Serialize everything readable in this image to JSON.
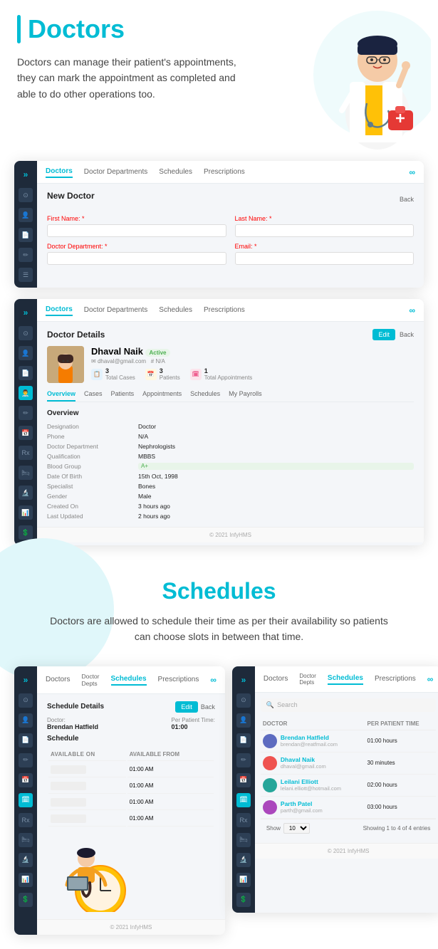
{
  "doctors_section": {
    "title": "Doctors",
    "description": "Doctors can manage their patient's appointments, they can mark the appointment as completed and able to do other operations too."
  },
  "app1": {
    "nav_tabs": [
      "Doctors",
      "Doctor Departments",
      "Schedules",
      "Prescriptions"
    ],
    "active_tab": "Doctors",
    "logo": "∞",
    "form_title": "New Doctor",
    "back_label": "Back",
    "fields": {
      "first_name": "First Name: *",
      "last_name": "Last Name: *",
      "doctor_dept": "Doctor Department: *",
      "email": "Email: *"
    }
  },
  "app2": {
    "nav_tabs": [
      "Doctors",
      "Doctor Departments",
      "Schedules",
      "Prescriptions"
    ],
    "active_tab": "Doctors",
    "logo": "∞",
    "section_title": "Doctor Details",
    "edit_btn": "Edit",
    "back_btn": "Back",
    "doctor": {
      "name": "Dhaval Naik",
      "status": "Active",
      "email": "dhaval@gmail.com",
      "id": "N/A",
      "stats": {
        "cases": "3",
        "cases_label": "Total Cases",
        "patients": "3",
        "patients_label": "Patients",
        "appointments": "1",
        "appointments_label": "Total Appointments"
      }
    },
    "sub_tabs": [
      "Overview",
      "Cases",
      "Patients",
      "Appointments",
      "Schedules",
      "My Payrolls"
    ],
    "active_sub_tab": "Overview",
    "overview_title": "Overview",
    "overview_fields": [
      {
        "key": "Designation",
        "value": "Doctor"
      },
      {
        "key": "Phone",
        "value": "N/A"
      },
      {
        "key": "Doctor Department",
        "value": "Nephrologists"
      },
      {
        "key": "Qualification",
        "value": "MBBS"
      },
      {
        "key": "Blood Group",
        "value": "A+",
        "highlight": true
      },
      {
        "key": "Date Of Birth",
        "value": "15th Oct, 1998"
      },
      {
        "key": "Specialist",
        "value": "Bones"
      },
      {
        "key": "Gender",
        "value": "Male"
      },
      {
        "key": "Created On",
        "value": "3 hours ago"
      },
      {
        "key": "Last Updated",
        "value": "2 hours ago"
      }
    ],
    "footer": "© 2021 InfyHMS"
  },
  "schedules_section": {
    "title": "Schedules",
    "description": "Doctors are allowed to schedule their time as per their availability so patients can choose slots in between that time."
  },
  "app3": {
    "nav_tabs": [
      "Doctors",
      "Doctor Departments",
      "Schedules",
      "Prescriptions"
    ],
    "active_tab": "Schedules",
    "logo": "∞",
    "section_title": "Schedule Details",
    "edit_btn": "Edit",
    "back_btn": "Back",
    "doctor_label": "Doctor:",
    "doctor_value": "Brendan Hatfield",
    "patient_time_label": "Per Patient Time:",
    "patient_time_value": "01:00",
    "schedule_title": "Schedule",
    "avail_on_label": "AVAILABLE ON",
    "avail_from_label": "AVAILABLE FROM",
    "rows": [
      {
        "day": "",
        "from": "01:00 AM"
      },
      {
        "day": "",
        "from": "01:00 AM"
      },
      {
        "day": "",
        "from": "01:00 AM"
      },
      {
        "day": "",
        "from": "01:00 AM"
      }
    ],
    "footer": "© 2021 InfyHMS"
  },
  "app4": {
    "nav_tabs": [
      "Doctors",
      "Doctor Departments",
      "Schedules",
      "Prescriptions"
    ],
    "active_tab": "Schedules",
    "logo": "∞",
    "search_placeholder": "Search",
    "table_cols": [
      "DOCTOR",
      "PER PATIENT TIME"
    ],
    "doctors": [
      {
        "name": "Brendan Hatfield",
        "email": "brendan@reatfmail.com",
        "time": "01:00 hours",
        "avatar_color": "#5c6bc0"
      },
      {
        "name": "Dhaval Naik",
        "email": "dhaval@gmail.com",
        "time": "30 minutes",
        "avatar_color": "#ef5350"
      },
      {
        "name": "Leilani Elliott",
        "email": "lelani.elliott@hotmail.com",
        "time": "02:00 hours",
        "avatar_color": "#26a69a"
      },
      {
        "name": "Parth Patel",
        "email": "parth@gmail.com",
        "time": "03:00 hours",
        "avatar_color": "#ab47bc"
      }
    ],
    "show_label": "Show",
    "show_value": "10",
    "pagination_text": "Showing 1 to 4 of 4 entries",
    "footer": "© 2021 InfyHMS"
  }
}
